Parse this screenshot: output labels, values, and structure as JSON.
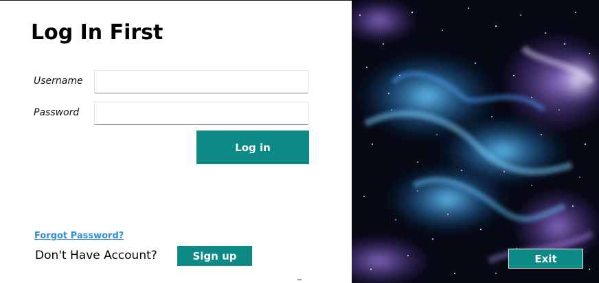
{
  "window": {
    "title": "Log In First"
  },
  "form": {
    "username_label": "Username",
    "password_label": "Password",
    "username_value": "",
    "password_value": "",
    "login_label": "Log in"
  },
  "footer": {
    "forgot_label": "Forgot Password?",
    "no_account_text": "Don't Have Account?",
    "signup_label": "Sign up"
  },
  "side_image": {
    "description_icon": "galaxy-nebula-image",
    "exit_label": "Exit"
  },
  "colors": {
    "accent": "#0d8a86",
    "link": "#2f8fd8",
    "text": "#000000"
  }
}
